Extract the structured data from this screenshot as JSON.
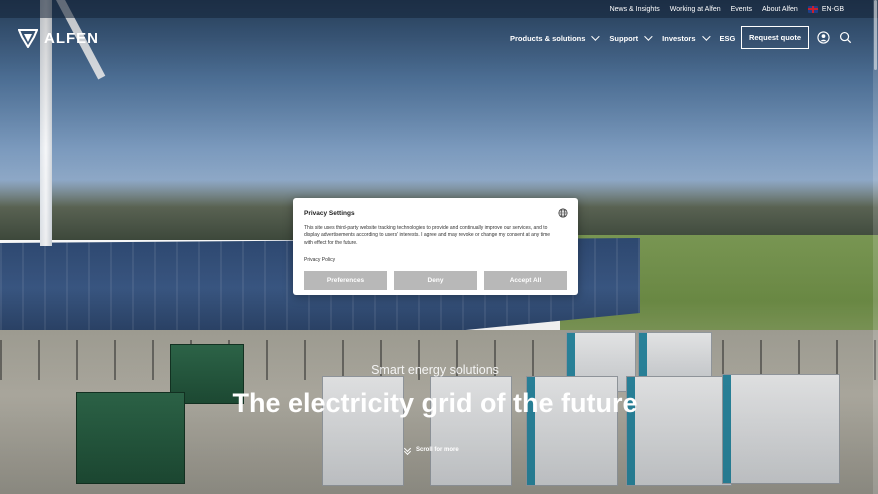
{
  "topbar": {
    "links": [
      "News & Insights",
      "Working at Alfen",
      "Events",
      "About Alfen"
    ],
    "language": "EN-GB"
  },
  "nav": {
    "logo_text": "ALFEN",
    "menu": [
      {
        "label": "Products & solutions",
        "dropdown": true
      },
      {
        "label": "Support",
        "dropdown": true
      },
      {
        "label": "Investors",
        "dropdown": true
      },
      {
        "label": "ESG",
        "dropdown": false
      }
    ],
    "quote_button": "Request quote",
    "icons": [
      "user-icon",
      "search-icon"
    ]
  },
  "hero": {
    "subtitle": "Smart energy solutions",
    "title": "The electricity grid of the future",
    "scroll_label": "Scroll for more"
  },
  "privacy_modal": {
    "title": "Privacy Settings",
    "body": "This site uses third-party website tracking technologies to provide and continually improve our services, and to display advertisements according to users' interests. I agree and may revoke or change my consent at any time with effect for the future.",
    "policy_link": "Privacy Policy",
    "buttons": {
      "preferences": "Preferences",
      "deny": "Deny",
      "accept": "Accept All"
    }
  },
  "colors": {
    "button_gray": "#b8b8b8",
    "modal_bg": "#ffffff",
    "nav_text": "#ffffff"
  }
}
